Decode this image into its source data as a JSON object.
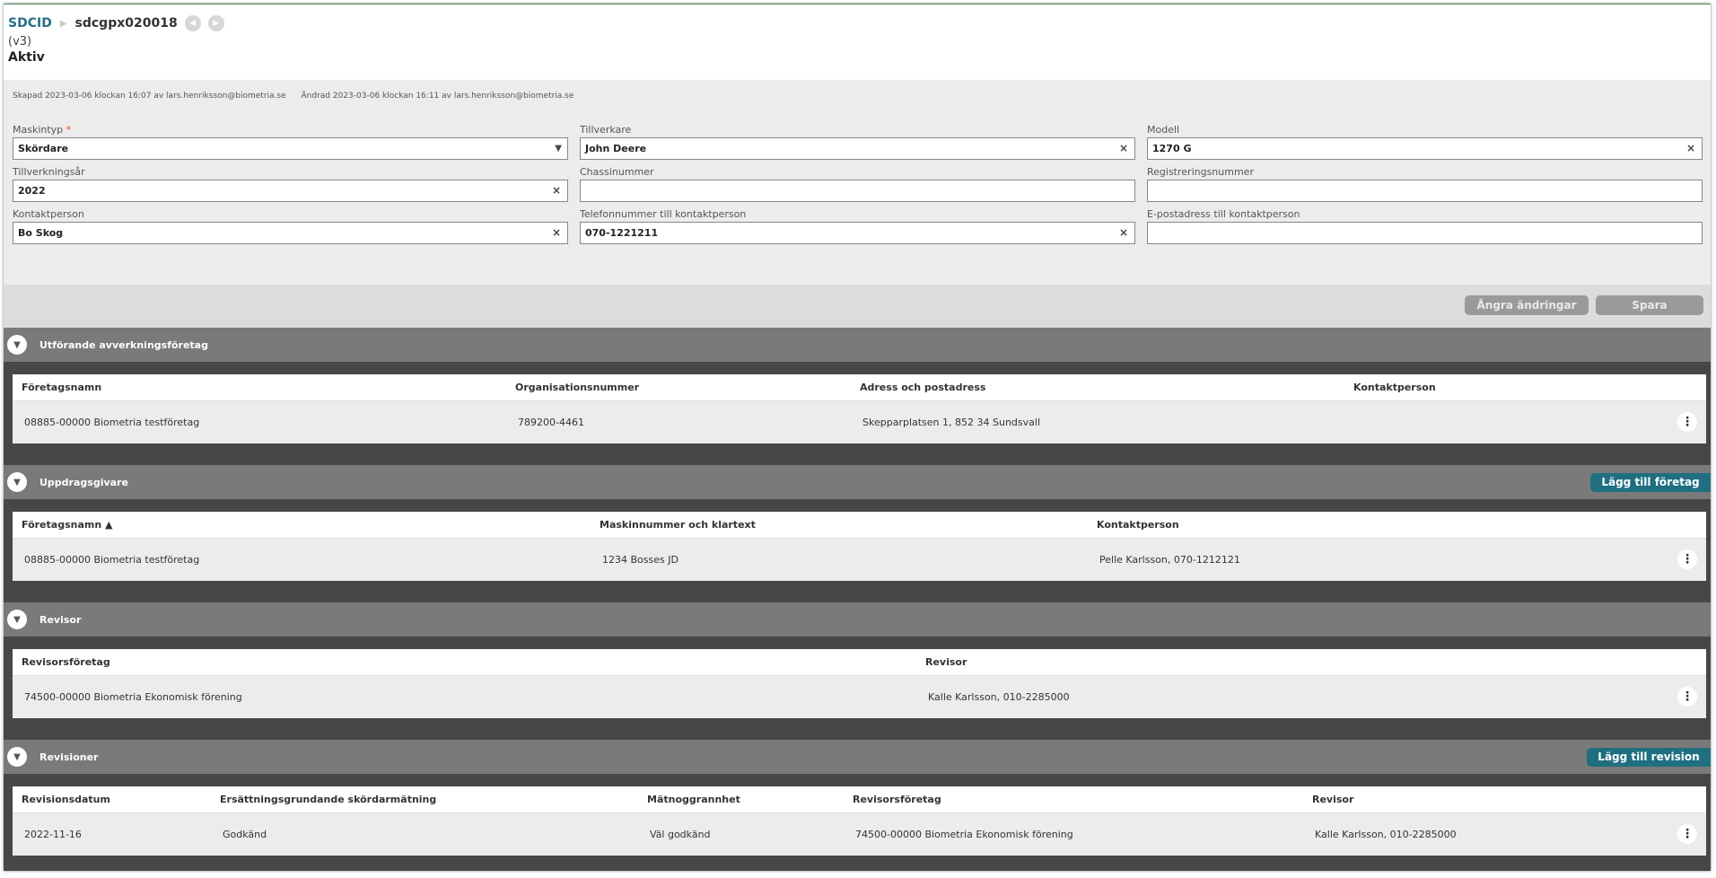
{
  "breadcrumb": {
    "root": "SDCID",
    "separator": "▶",
    "current": "sdcgpx020018",
    "prev_icon": "◀",
    "next_icon": "▶"
  },
  "version": "(v3)",
  "status": "Aktiv",
  "meta": {
    "created": "Skapad 2023-03-06 klockan 16:07 av lars.henriksson@biometria.se",
    "changed": "Ändrad 2023-03-06 klockan 16:11 av lars.henriksson@biometria.se"
  },
  "form": {
    "required_mark": "*",
    "clear_icon": "×",
    "dropdown_icon": "▼",
    "maskintyp": {
      "label": "Maskintyp",
      "value": "Skördare"
    },
    "tillverkare": {
      "label": "Tillverkare",
      "value": "John Deere"
    },
    "modell": {
      "label": "Modell",
      "value": "1270 G"
    },
    "tillverkningsar": {
      "label": "Tillverkningsår",
      "value": "2022"
    },
    "chassinummer": {
      "label": "Chassinummer",
      "value": ""
    },
    "registreringsnummer": {
      "label": "Registreringsnummer",
      "value": ""
    },
    "kontaktperson": {
      "label": "Kontaktperson",
      "value": "Bo Skog"
    },
    "telefon": {
      "label": "Telefonnummer till kontaktperson",
      "value": "070-1221211"
    },
    "epost": {
      "label": "E-postadress till kontaktperson",
      "value": ""
    }
  },
  "actions": {
    "undo": "Ångra ändringar",
    "save": "Spara"
  },
  "toggle_icon": "▼",
  "kebab_icon": "⋮",
  "sections": {
    "utforande": {
      "title": "Utförande avverkningsföretag",
      "headers": [
        "Företagsnamn",
        "Organisationsnummer",
        "Adress och postadress",
        "Kontaktperson"
      ],
      "row": [
        "08885-00000 Biometria testföretag",
        "789200-4461",
        "Skepparplatsen 1, 852 34 Sundsvall",
        ""
      ]
    },
    "uppdragsgivare": {
      "title": "Uppdragsgivare",
      "button": "Lägg till företag",
      "headers": [
        "Företagsnamn  ▲",
        "Maskinnummer och klartext",
        "Kontaktperson"
      ],
      "row": [
        "08885-00000 Biometria testföretag",
        "1234 Bosses JD",
        "Pelle Karlsson, 070-1212121"
      ]
    },
    "revisor": {
      "title": "Revisor",
      "headers": [
        "Revisorsföretag",
        "Revisor"
      ],
      "row": [
        "74500-00000 Biometria Ekonomisk förening",
        "Kalle Karlsson, 010-2285000"
      ]
    },
    "revisioner": {
      "title": "Revisioner",
      "button": "Lägg till revision",
      "headers": [
        "Revisionsdatum",
        "Ersättningsgrundande skördarmätning",
        "Mätnoggrannhet",
        "Revisorsföretag",
        "Revisor"
      ],
      "row": [
        "2022-11-16",
        "Godkänd",
        "Väl godkänd",
        "74500-00000 Biometria Ekonomisk förening",
        "Kalle Karlsson, 010-2285000"
      ]
    }
  }
}
